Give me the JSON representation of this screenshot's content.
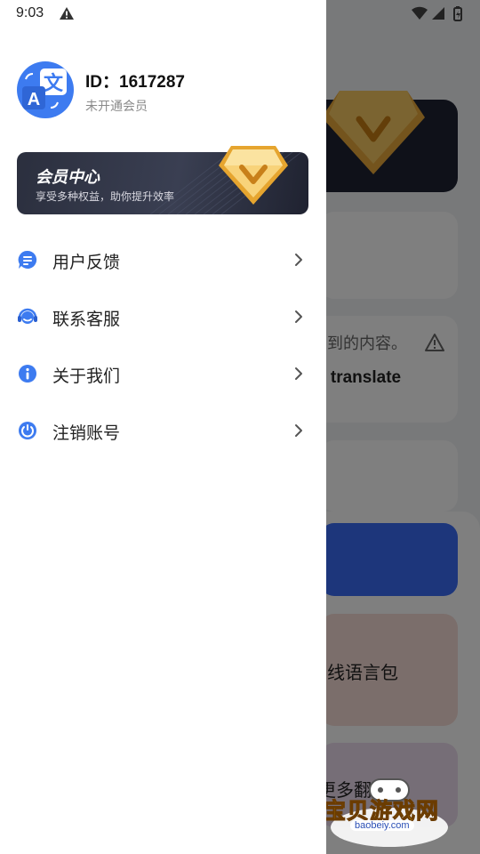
{
  "status_bar": {
    "time": "9:03",
    "alert_icon": "warning-icon",
    "wifi_icon": "wifi-icon",
    "signal_icon": "signal-icon",
    "battery_icon": "battery-icon"
  },
  "profile": {
    "id_label": "ID：1617287",
    "member_status": "未开通会员",
    "avatar_icon": "translate-icon"
  },
  "vip_card": {
    "title": "会员中心",
    "subtitle": "享受多种权益，助你提升效率",
    "icon": "vip-diamond-icon"
  },
  "menu": [
    {
      "label": "用户反馈",
      "icon": "feedback-icon"
    },
    {
      "label": "联系客服",
      "icon": "headset-icon"
    },
    {
      "label": "关于我们",
      "icon": "info-icon"
    },
    {
      "label": "注销账号",
      "icon": "power-icon"
    }
  ],
  "background": {
    "hint_text": "到的内容。",
    "translate_text": "o translate",
    "offline_text": "线语言包",
    "more_text": "更多翻"
  },
  "watermark": {
    "title": "宝贝游戏网",
    "url": "baobeiy.com"
  },
  "colors": {
    "accent": "#3d7bf0",
    "vip_dark": "#2b2f3e",
    "gold": "#f2b63a"
  }
}
